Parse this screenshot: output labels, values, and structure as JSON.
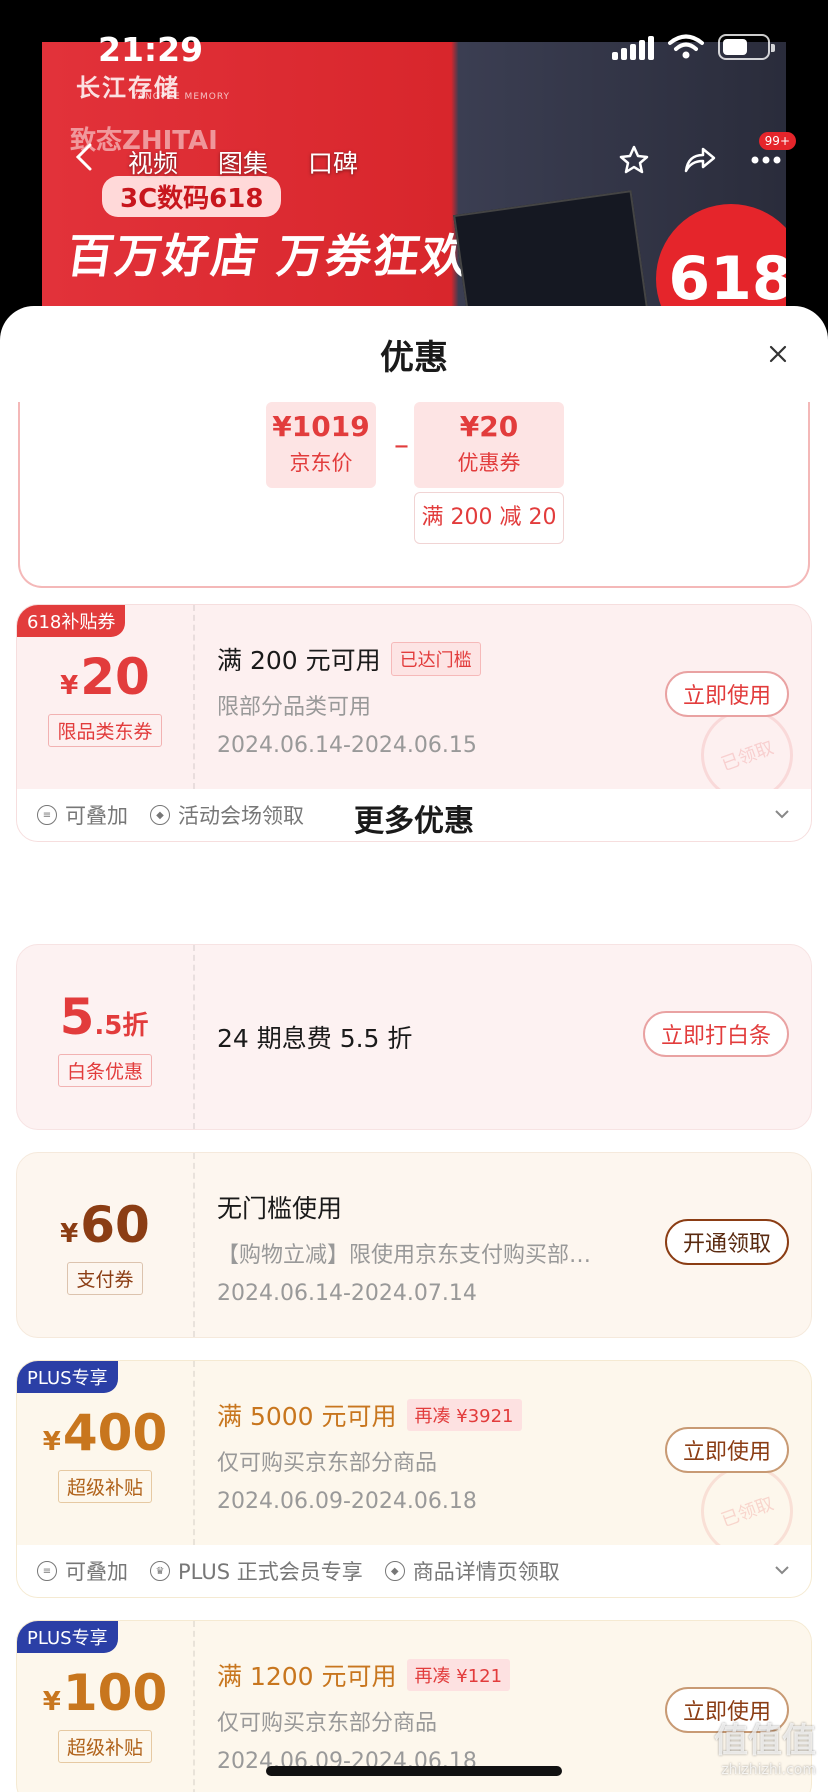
{
  "status": {
    "time": "21:29"
  },
  "hero": {
    "brand": "长江存储",
    "brand_en": "YANGTZE MEMORY",
    "line1": "致态ZHITAI",
    "pill": "3C数码618",
    "headline": "百万好店 万券狂欢",
    "badge": "618"
  },
  "nav": {
    "tabs": [
      "视频",
      "图集",
      "口碑"
    ],
    "msg_badge": "99+"
  },
  "sheet": {
    "title": "优惠",
    "calc": {
      "price_value": "¥1019",
      "price_label": "京东价",
      "minus": "–",
      "coupon_value": "¥20",
      "coupon_label": "优惠券",
      "rule": "满 200 减 20"
    },
    "coupons": [
      {
        "corner": "618补贴券",
        "currency": "¥",
        "amount": "20",
        "tag": "限品类东券",
        "title": "满 200 元可用",
        "pill": "已达门槛",
        "desc": "限部分品类可用",
        "date": "2024.06.14-2024.06.15",
        "button": "立即使用",
        "stamp": "已领取",
        "foot": [
          "可叠加",
          "活动会场领取"
        ]
      }
    ],
    "more_title": "更多优惠",
    "more": [
      {
        "amount_big": "5",
        "amount_small": ".5折",
        "tag": "白条优惠",
        "title": "24 期息费 5.5 折",
        "button": "立即打白条"
      },
      {
        "currency": "¥",
        "amount": "60",
        "tag": "支付券",
        "title": "无门槛使用",
        "desc": "【购物立减】限使用京东支付购买部…",
        "date": "2024.06.14-2024.07.14",
        "button": "开通领取"
      },
      {
        "corner": "PLUS专享",
        "currency": "¥",
        "amount": "400",
        "tag": "超级补贴",
        "title": "满 5000 元可用",
        "pill": "再凑 ¥3921",
        "desc": "仅可购买京东部分商品",
        "date": "2024.06.09-2024.06.18",
        "button": "立即使用",
        "stamp": "已领取",
        "foot": [
          "可叠加",
          "PLUS 正式会员专享",
          "商品详情页领取"
        ]
      },
      {
        "corner": "PLUS专享",
        "currency": "¥",
        "amount": "100",
        "tag": "超级补贴",
        "title": "满 1200 元可用",
        "pill": "再凑 ¥121",
        "desc": "仅可购买京东部分商品",
        "date": "2024.06.09-2024.06.18",
        "button": "立即使用"
      }
    ]
  },
  "watermark": {
    "line1": "值值值",
    "line2": "zhizhizhi.com"
  },
  "colors": {
    "red": "#e23c3c",
    "brown": "#8b3d14",
    "gold": "#c8761e",
    "plus_blue": "#2b3fa6"
  }
}
